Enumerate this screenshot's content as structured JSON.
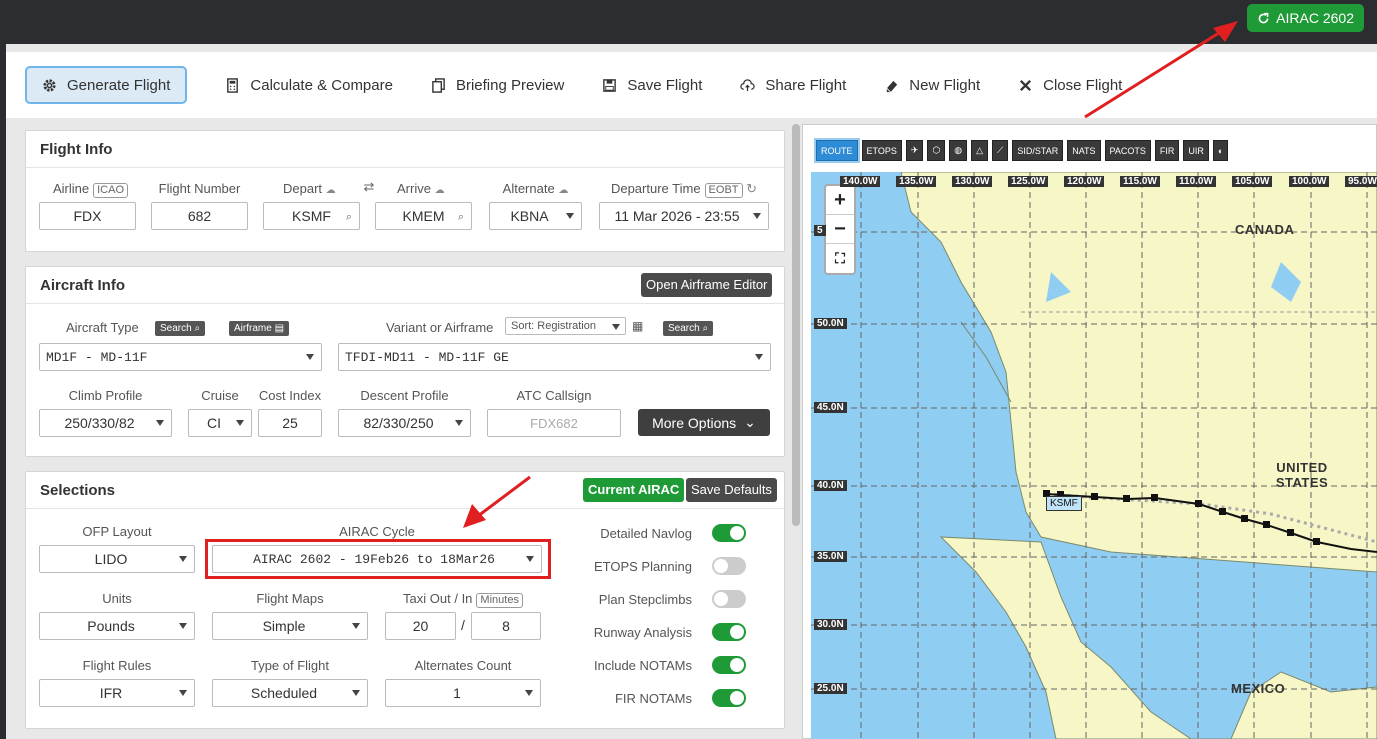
{
  "topbar": {
    "airac_button": "AIRAC 2602"
  },
  "toolbar": [
    {
      "label": "Generate Flight",
      "icon": "gear-icon"
    },
    {
      "label": "Calculate & Compare",
      "icon": "calculator-icon"
    },
    {
      "label": "Briefing Preview",
      "icon": "copy-icon"
    },
    {
      "label": "Save Flight",
      "icon": "save-icon"
    },
    {
      "label": "Share Flight",
      "icon": "cloud-upload-icon"
    },
    {
      "label": "New Flight",
      "icon": "eraser-icon"
    },
    {
      "label": "Close Flight",
      "icon": "close-icon"
    }
  ],
  "flight_info": {
    "title": "Flight Info",
    "airline_label": "Airline",
    "airline_tag": "ICAO",
    "airline": "FDX",
    "flight_number_label": "Flight Number",
    "flight_number": "682",
    "depart_label": "Depart",
    "depart": "KSMF",
    "arrive_label": "Arrive",
    "arrive": "KMEM",
    "alternate_label": "Alternate",
    "alternate": "KBNA",
    "departure_time_label": "Departure Time",
    "departure_time_tag": "EOBT",
    "departure_time": "11 Mar 2026 - 23:55"
  },
  "aircraft_info": {
    "title": "Aircraft Info",
    "open_editor": "Open Airframe Editor",
    "aircraft_type_label": "Aircraft Type",
    "search_btn": "Search",
    "airframe_btn": "Airframe",
    "aircraft_type": "MD1F - MD-11F",
    "variant_label": "Variant or Airframe",
    "sort_value": "Sort: Registration",
    "search_btn2": "Search",
    "variant": "TFDI-MD11 - MD-11F GE",
    "climb_label": "Climb Profile",
    "climb": "250/330/82",
    "cruise_label": "Cruise",
    "cruise": "CI",
    "cost_index_label": "Cost Index",
    "cost_index": "25",
    "descent_label": "Descent Profile",
    "descent": "82/330/250",
    "atc_label": "ATC Callsign",
    "atc_placeholder": "FDX682",
    "more_options": "More Options"
  },
  "selections": {
    "title": "Selections",
    "current_airac": "Current AIRAC",
    "save_defaults": "Save Defaults",
    "ofp_layout_label": "OFP Layout",
    "ofp_layout": "LIDO",
    "airac_cycle_label": "AIRAC Cycle",
    "airac_cycle": "AIRAC 2602 - 19Feb26 to 18Mar26",
    "units_label": "Units",
    "units": "Pounds",
    "flight_maps_label": "Flight Maps",
    "flight_maps": "Simple",
    "taxi_label": "Taxi Out / In",
    "taxi_tag": "Minutes",
    "taxi_out": "20",
    "taxi_sep": "/",
    "taxi_in": "8",
    "flight_rules_label": "Flight Rules",
    "flight_rules": "IFR",
    "type_of_flight_label": "Type of Flight",
    "type_of_flight": "Scheduled",
    "alternates_count_label": "Alternates Count",
    "alternates_count": "1",
    "toggles": [
      {
        "label": "Detailed Navlog",
        "on": true
      },
      {
        "label": "ETOPS Planning",
        "on": false
      },
      {
        "label": "Plan Stepclimbs",
        "on": false
      },
      {
        "label": "Runway Analysis",
        "on": true
      },
      {
        "label": "Include NOTAMs",
        "on": true
      },
      {
        "label": "FIR NOTAMs",
        "on": true
      }
    ]
  },
  "map": {
    "tools": [
      "ROUTE",
      "ETOPS",
      "SID/STAR",
      "NATS",
      "PACOTS",
      "FIR",
      "UIR"
    ],
    "zoom_in": "+",
    "zoom_out": "−",
    "lon_labels": [
      "140.0W",
      "135.0W",
      "130.0W",
      "125.0W",
      "120.0W",
      "115.0W",
      "110.0W",
      "105.0W",
      "100.0W",
      "95.0W"
    ],
    "lat_labels": [
      "50.0N",
      "45.0N",
      "40.0N",
      "35.0N",
      "30.0N",
      "25.0N"
    ],
    "lat_partial": "5",
    "countries": {
      "canada": "CANADA",
      "us": "UNITED STATES",
      "mexico": "MEXICO"
    },
    "departure_marker": "KSMF"
  }
}
